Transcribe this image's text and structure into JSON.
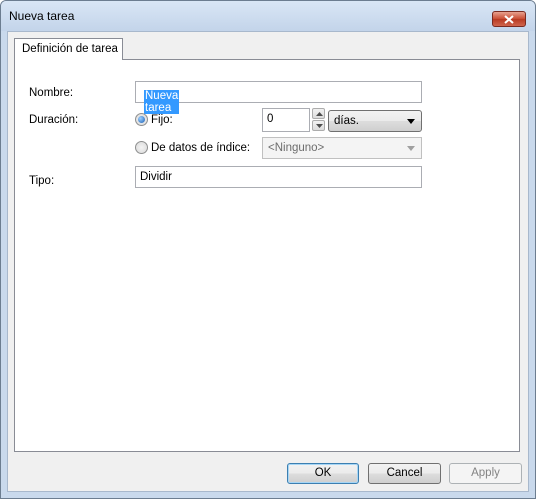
{
  "window": {
    "title": "Nueva tarea"
  },
  "tabs": [
    {
      "label": "Definición de tarea"
    }
  ],
  "form": {
    "nombre_label": "Nombre:",
    "nombre_value": "Nueva tarea",
    "duracion_label": "Duración:",
    "fijo_label": "Fijo:",
    "fijo_value": "0",
    "unidad_value": "días.",
    "indice_label": "De datos de índice:",
    "indice_value": "<Ninguno>",
    "tipo_label": "Tipo:",
    "tipo_value": "Dividir"
  },
  "buttons": {
    "ok": "OK",
    "cancel": "Cancel",
    "apply": "Apply"
  },
  "icons": {
    "close": "close-icon",
    "spin_up": "arrow-up-icon",
    "spin_down": "arrow-down-icon",
    "dropdown": "chevron-down-icon"
  }
}
